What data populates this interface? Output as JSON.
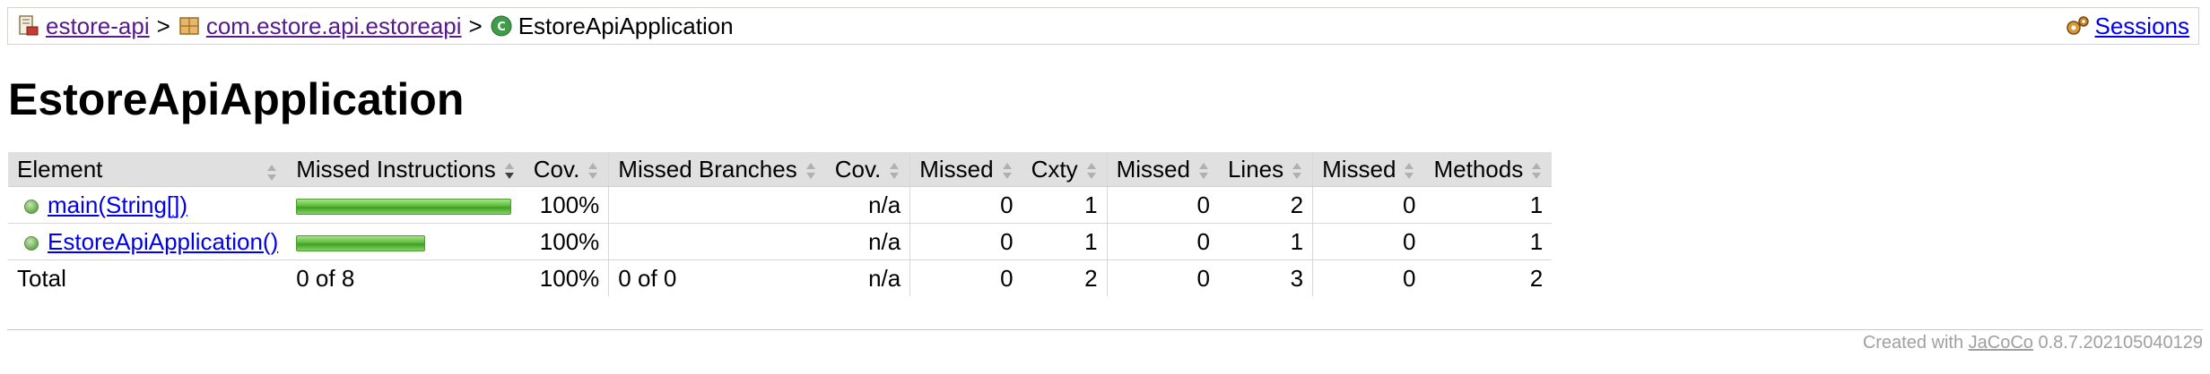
{
  "breadcrumb": {
    "items": [
      {
        "label": "estore-api",
        "icon": "project-icon"
      },
      {
        "label": "com.estore.api.estoreapi",
        "icon": "package-icon"
      },
      {
        "label": "EstoreApiApplication",
        "icon": "class-icon"
      }
    ],
    "separator": ">",
    "sessions_label": "Sessions"
  },
  "page": {
    "title": "EstoreApiApplication"
  },
  "table": {
    "headers": [
      "Element",
      "Missed Instructions",
      "Cov.",
      "Missed Branches",
      "Cov.",
      "Missed",
      "Cxty",
      "Missed",
      "Lines",
      "Missed",
      "Methods"
    ],
    "rows": [
      {
        "element": "main(String[])",
        "instr_fraction": 1.0,
        "instr_cov": "100%",
        "branches": "",
        "branch_cov": "n/a",
        "missed_cxty": "0",
        "cxty": "1",
        "missed_lines": "0",
        "lines": "2",
        "missed_methods": "0",
        "methods": "1"
      },
      {
        "element": "EstoreApiApplication()",
        "instr_fraction": 0.6,
        "instr_cov": "100%",
        "branches": "",
        "branch_cov": "n/a",
        "missed_cxty": "0",
        "cxty": "1",
        "missed_lines": "0",
        "lines": "1",
        "missed_methods": "0",
        "methods": "1"
      }
    ],
    "total": {
      "label": "Total",
      "instr": "0 of 8",
      "instr_cov": "100%",
      "branches": "0 of 0",
      "branch_cov": "n/a",
      "missed_cxty": "0",
      "cxty": "2",
      "missed_lines": "0",
      "lines": "3",
      "missed_methods": "0",
      "methods": "2"
    }
  },
  "footer": {
    "prefix": "Created with",
    "link": "JaCoCo",
    "version": "0.8.7.202105040129"
  },
  "colors": {
    "coverage_green": "#5cbc3a",
    "header_bg": "#e0e0e0",
    "link_visited": "#551a8b",
    "link": "#0000ee"
  }
}
